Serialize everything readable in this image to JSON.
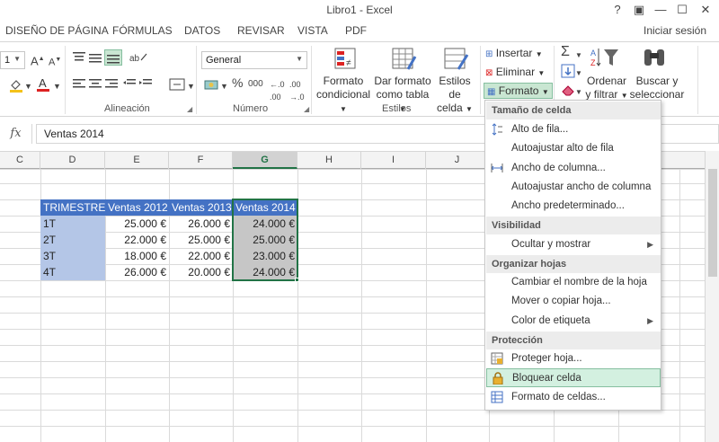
{
  "window": {
    "title": "Libro1 - Excel",
    "help": "?",
    "restore_ribbon": "▣",
    "minimize": "—",
    "maximize": "☐",
    "close": "✕"
  },
  "tabs": {
    "page_layout": "DISEÑO DE PÁGINA",
    "formulas": "FÓRMULAS",
    "data": "DATOS",
    "review": "REVISAR",
    "view": "VISTA",
    "pdf": "PDF",
    "signin": "Iniciar sesión"
  },
  "ribbon": {
    "font_size": "1",
    "number_format": "General",
    "percent": "%",
    "thousands": "000",
    "alignment_label": "Alineación",
    "number_label": "Número",
    "styles_label": "Estilos",
    "conditional_format": [
      "Formato",
      "condicional"
    ],
    "format_as_table": [
      "Dar formato",
      "como tabla"
    ],
    "cell_styles": [
      "Estilos de",
      "celda"
    ],
    "insert": "Insertar",
    "delete": "Eliminar",
    "format": "Formato",
    "sort_filter": [
      "Ordenar",
      "y filtrar"
    ],
    "find_select": [
      "Buscar y",
      "seleccionar"
    ]
  },
  "formula_bar": {
    "fx": "fx",
    "value": "Ventas 2014"
  },
  "columns": [
    "C",
    "D",
    "E",
    "F",
    "G",
    "H",
    "I",
    "J"
  ],
  "selected_column": "G",
  "table": {
    "headers": [
      "TRIMESTRE",
      "Ventas 2012",
      "Ventas 2013",
      "Ventas 2014"
    ],
    "rows": [
      [
        "1T",
        "25.000 €",
        "26.000 €",
        "24.000 €"
      ],
      [
        "2T",
        "22.000 €",
        "25.000 €",
        "25.000 €"
      ],
      [
        "3T",
        "18.000 €",
        "22.000 €",
        "23.000 €"
      ],
      [
        "4T",
        "26.000 €",
        "20.000 €",
        "24.000 €"
      ]
    ]
  },
  "menu": {
    "section_cell_size": "Tamaño de celda",
    "row_height": "Alto de fila...",
    "autofit_row": "Autoajustar alto de fila",
    "column_width": "Ancho de columna...",
    "autofit_column": "Autoajustar ancho de columna",
    "default_width": "Ancho predeterminado...",
    "section_visibility": "Visibilidad",
    "hide_unhide": "Ocultar y mostrar",
    "section_organize": "Organizar hojas",
    "rename_sheet": "Cambiar el nombre de la hoja",
    "move_copy": "Mover o copiar hoja...",
    "tab_color": "Color de etiqueta",
    "section_protection": "Protección",
    "protect_sheet": "Proteger hoja...",
    "lock_cell": "Bloquear celda",
    "format_cells": "Formato de celdas..."
  }
}
